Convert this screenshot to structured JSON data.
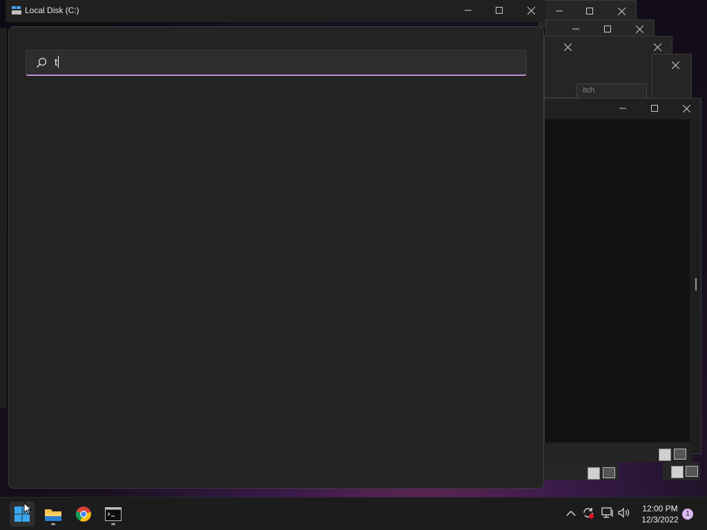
{
  "explorer": {
    "title": "Local Disk (C:)",
    "minimize": "minimize",
    "maximize": "maximize",
    "close": "close"
  },
  "background_window_fragment": {
    "text": "itch"
  },
  "search": {
    "value": "t"
  },
  "taskbar": {
    "apps": [
      {
        "name": "Start",
        "icon": "windows-start-icon"
      },
      {
        "name": "File Explorer",
        "icon": "folder-icon"
      },
      {
        "name": "Google Chrome",
        "icon": "chrome-icon"
      },
      {
        "name": "Terminal",
        "icon": "terminal-icon"
      }
    ],
    "clock_time": "12:00 PM",
    "clock_date": "12/3/2022",
    "notification_count": "1"
  },
  "colors": {
    "accent": "#c58fd9",
    "taskbar": "#1c1c1c",
    "window": "#232323"
  }
}
